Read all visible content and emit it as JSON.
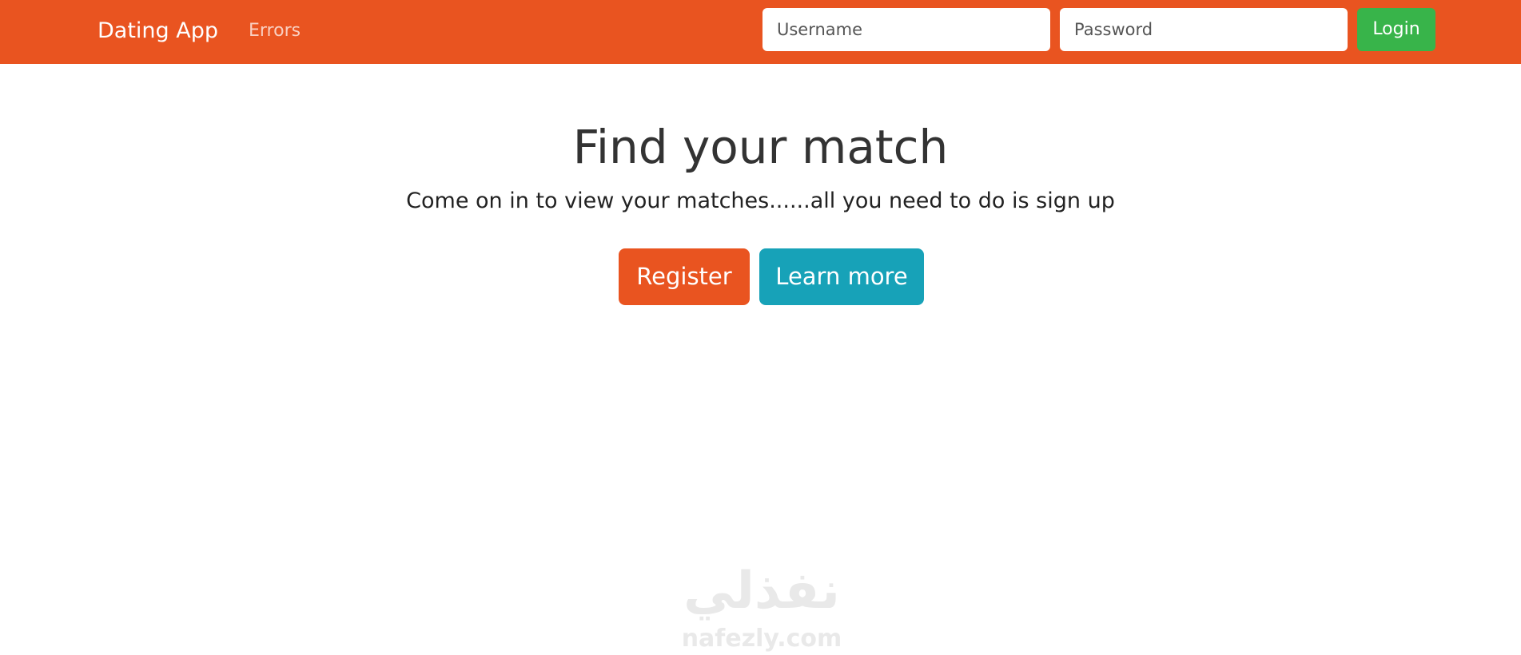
{
  "navbar": {
    "brand": "Dating App",
    "links": [
      {
        "label": "Errors"
      }
    ],
    "login_form": {
      "username_placeholder": "Username",
      "password_placeholder": "Password",
      "login_label": "Login"
    }
  },
  "hero": {
    "title": "Find your match",
    "subtitle": "Come on in to view your matches......all you need to do is sign up",
    "register_label": "Register",
    "learn_more_label": "Learn more"
  },
  "watermark": {
    "arabic_text": "نفذلي",
    "latin_text": "nafezly.com"
  },
  "colors": {
    "primary": "#e95420",
    "success": "#38b44a",
    "info": "#17a2b8"
  }
}
